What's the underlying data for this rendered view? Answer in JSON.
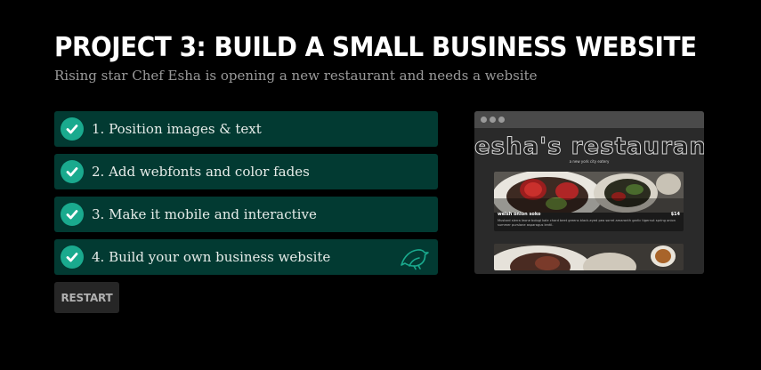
{
  "project": {
    "title": "PROJECT 3: BUILD A SMALL BUSINESS WEBSITE",
    "subtitle": "Rising star Chef Esha is opening a new restaurant and needs a website"
  },
  "tasks": [
    {
      "label": "1. Position images & text",
      "completed": true
    },
    {
      "label": "2. Add webfonts and color fades",
      "completed": true
    },
    {
      "label": "3. Make it mobile and interactive",
      "completed": true
    },
    {
      "label": "4. Build your own business website",
      "completed": true
    }
  ],
  "restart_label": "RESTART",
  "preview": {
    "site_title": "esha's restaurant",
    "tagline": "a new york city eatery",
    "dish_name": "welsh onion soko",
    "dish_price": "$14",
    "dish_description": "Mustard sierra leone bologi kale chard beet greens black-eyed pea sorrel amaranth garlic tigernut spring onion summer purslane asparagus lentil."
  },
  "colors": {
    "task_bg": "#023a32",
    "check_bg": "#1aaa8e",
    "bird_icon": "#1aaa8e"
  },
  "icons": {
    "task_check": "check-circle-icon",
    "task_extra": "bird-icon"
  }
}
